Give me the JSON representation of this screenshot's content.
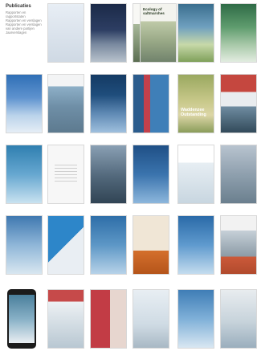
{
  "sidebar": {
    "title": "Publicaties",
    "links": [
      "Rapporten en rapportstaten",
      "Rapporten en verslagen",
      "Rapporten en verslagen van andere partijen",
      "Jaarverslagen"
    ]
  },
  "covers": [
    {
      "title": ""
    },
    {
      "title": ""
    },
    {
      "title": ""
    },
    {
      "title": "Ecology of saltmarshes"
    },
    {
      "title": ""
    },
    {
      "title": ""
    },
    {
      "title": ""
    },
    {
      "title": ""
    },
    {
      "title": ""
    },
    {
      "title": ""
    },
    {
      "title": ""
    },
    {
      "title": "Waddenzee Outstanding"
    },
    {
      "title": ""
    },
    {
      "title": ""
    },
    {
      "title": ""
    },
    {
      "title": ""
    },
    {
      "title": ""
    },
    {
      "title": ""
    },
    {
      "title": ""
    },
    {
      "title": ""
    },
    {
      "title": ""
    },
    {
      "title": ""
    },
    {
      "title": ""
    },
    {
      "title": ""
    },
    {
      "title": ""
    },
    {
      "title": ""
    },
    {
      "title": ""
    },
    {
      "title": ""
    },
    {
      "title": ""
    },
    {
      "title": ""
    },
    {
      "title": ""
    },
    {
      "title": ""
    },
    {
      "title": ""
    },
    {
      "title": ""
    },
    {
      "title": ""
    }
  ]
}
